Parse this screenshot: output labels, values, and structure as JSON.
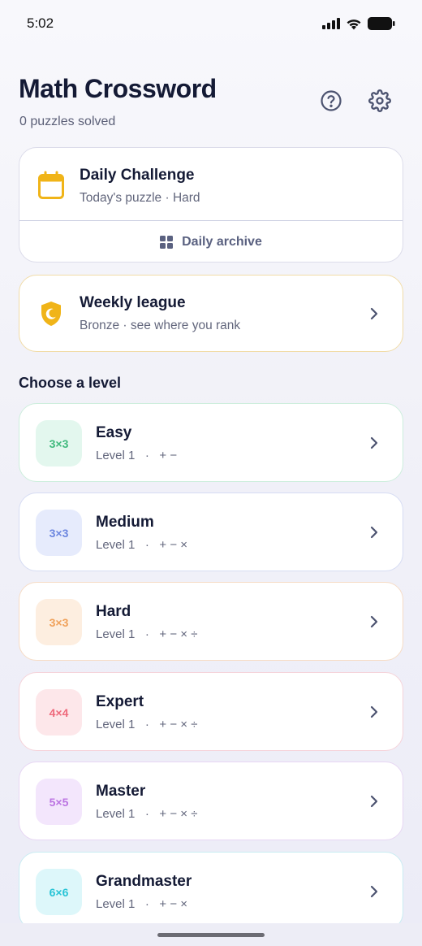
{
  "status_bar": {
    "time": "5:02"
  },
  "header": {
    "title": "Math Crossword",
    "subtitle": "0 puzzles solved",
    "help_icon": "help-circle-icon",
    "settings_icon": "gear-icon"
  },
  "daily": {
    "title": "Daily Challenge",
    "subtitle": "Today's puzzle · Hard",
    "icon": "calendar-icon",
    "archive_label": "Daily archive",
    "archive_icon": "grid-icon"
  },
  "league": {
    "title": "Weekly league",
    "subtitle": "Bronze · see where you rank",
    "icon": "shield-moon-icon"
  },
  "section_title": "Choose a level",
  "levels": [
    {
      "badge": "3×3",
      "name": "Easy",
      "level": "Level 1",
      "sep": "·",
      "ops": "+ −",
      "badge_bg": "#e3f7ee",
      "badge_fg": "#3fb97c",
      "border": "#cdeedd"
    },
    {
      "badge": "3×3",
      "name": "Medium",
      "level": "Level 1",
      "sep": "·",
      "ops": "+ − ×",
      "badge_bg": "#e6ebfc",
      "badge_fg": "#6c86df",
      "border": "#d6dcf3"
    },
    {
      "badge": "3×3",
      "name": "Hard",
      "level": "Level 1",
      "sep": "·",
      "ops": "+ − × ÷",
      "badge_bg": "#fdeee0",
      "badge_fg": "#f0a15a",
      "border": "#f6dcc6"
    },
    {
      "badge": "4×4",
      "name": "Expert",
      "level": "Level 1",
      "sep": "·",
      "ops": "+ − × ÷",
      "badge_bg": "#fde7ea",
      "badge_fg": "#ee6a7c",
      "border": "#f5d3da"
    },
    {
      "badge": "5×5",
      "name": "Master",
      "level": "Level 1",
      "sep": "·",
      "ops": "+ − × ÷",
      "badge_bg": "#f3e6fc",
      "badge_fg": "#bb74e2",
      "border": "#e7d6f3"
    },
    {
      "badge": "6×6",
      "name": "Grandmaster",
      "level": "Level 1",
      "sep": "·",
      "ops": "+ − ×",
      "badge_bg": "#ddf7fa",
      "badge_fg": "#28c4d6",
      "border": "#c9ecf2"
    }
  ],
  "colors": {
    "accent_gold": "#f0b418",
    "text_primary": "#141a35",
    "text_secondary": "#62667c"
  }
}
